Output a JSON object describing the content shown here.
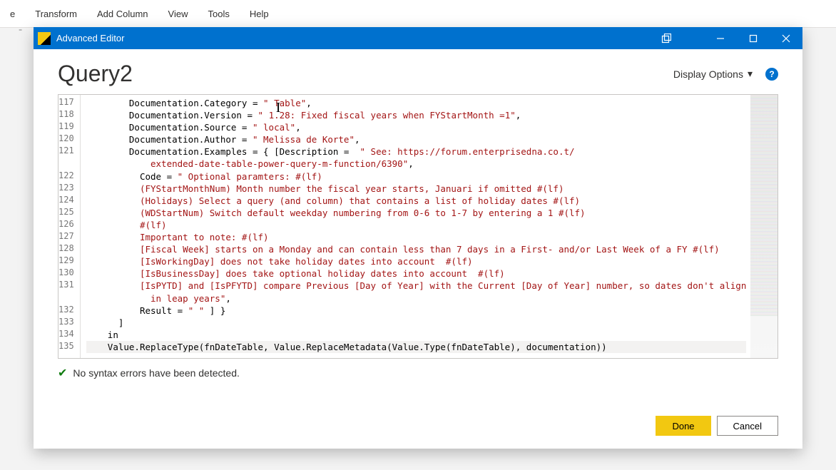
{
  "ribbon": {
    "tab_e": "e",
    "transform": "Transform",
    "addcolumn": "Add Column",
    "view": "View",
    "tools": "Tools",
    "help": "Help"
  },
  "titlebar": {
    "title": "Advanced Editor"
  },
  "header": {
    "query_name": "Query2",
    "display_options": "Display Options"
  },
  "gutter": {
    "l117": "117",
    "l118": "118",
    "l119": "119",
    "l120": "120",
    "l121": "121",
    "l121b": "",
    "l122": "122",
    "l123": "123",
    "l124": "124",
    "l125": "125",
    "l126": "126",
    "l127": "127",
    "l128": "128",
    "l129": "129",
    "l130": "130",
    "l131": "131",
    "l131b": "",
    "l132": "132",
    "l133": "133",
    "l134": "134",
    "l135": "135"
  },
  "code": {
    "l117a": "        Documentation.Category = ",
    "l117b": "\" Table\"",
    "l117c": ",",
    "l118a": "        Documentation.Version = ",
    "l118b": "\" 1.28: Fixed fiscal years when FYStartMonth =1\"",
    "l118c": ",",
    "l119a": "        Documentation.Source = ",
    "l119b": "\" local\"",
    "l119c": ",",
    "l120a": "        Documentation.Author = ",
    "l120b": "\" Melissa de Korte\"",
    "l120c": ",",
    "l121a": "        Documentation.Examples = { [Description =  ",
    "l121b": "\" See: https://forum.enterprisedna.co.t/",
    "l121c": "            extended-date-table-power-query-m-function/6390\"",
    "l121d": ",",
    "l122a": "          Code = ",
    "l122b": "\" Optional paramters: #(lf)",
    "l123": "          (FYStartMonthNum) Month number the fiscal year starts, Januari if omitted #(lf)",
    "l124": "          (Holidays) Select a query (and column) that contains a list of holiday dates #(lf)",
    "l125": "          (WDStartNum) Switch default weekday numbering from 0-6 to 1-7 by entering a 1 #(lf)",
    "l126": "          #(lf)",
    "l127": "          Important to note: #(lf)",
    "l128": "          [Fiscal Week] starts on a Monday and can contain less than 7 days in a First- and/or Last Week of a FY #(lf)",
    "l129": "          [IsWorkingDay] does not take holiday dates into account  #(lf)",
    "l130": "          [IsBusinessDay] does take optional holiday dates into account  #(lf)",
    "l131": "          [IsPYTD] and [IsPFYTD] compare Previous [Day of Year] with the Current [Day of Year] number, so dates don't align",
    "l131b": "            in leap years\"",
    "l131c": ",",
    "l132a": "          Result = ",
    "l132b": "\" \"",
    "l132c": " ] }",
    "l133": "      ]",
    "l134": "    in",
    "l135": "    Value.ReplaceType(fnDateTable, Value.ReplaceMetadata(Value.Type(fnDateTable), documentation))"
  },
  "status": {
    "text": "No syntax errors have been detected."
  },
  "footer": {
    "done": "Done",
    "cancel": "Cancel"
  }
}
